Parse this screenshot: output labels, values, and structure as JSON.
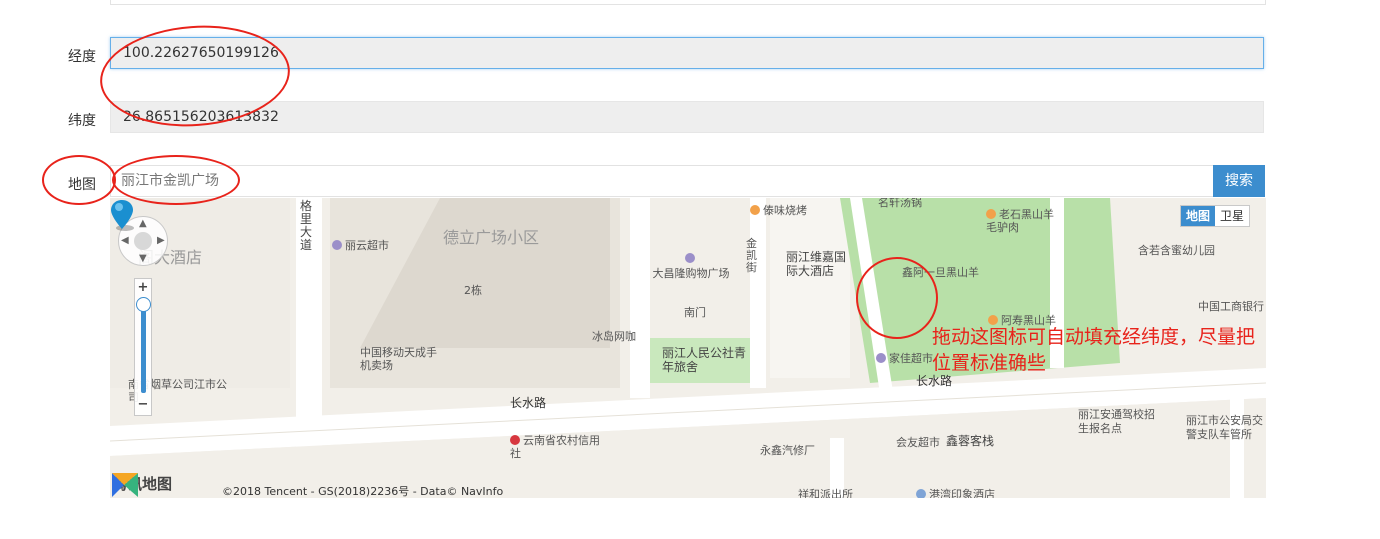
{
  "form": {
    "longitude": {
      "label": "经度",
      "value": "100.22627650199126"
    },
    "latitude": {
      "label": "纬度",
      "value": "26.865156203613832"
    },
    "map": {
      "label": "地图",
      "search_value": "丽江市金凯广场",
      "search_button": "搜索"
    }
  },
  "map": {
    "type_buttons": [
      "地图",
      "卫星"
    ],
    "active_type": "地图",
    "places": {
      "hotel_left": "阁大酒店",
      "road_vertical_1": "格里大道",
      "lijiang_yun": "丽云超市",
      "deli_plaza": "德立广场小区",
      "building_2": "2栋",
      "daichang": "大昌隆购物广场",
      "nanmen": "南门",
      "bingdao": "冰岛网咖",
      "mobile": "中国移动天成手机卖场",
      "yunnan_tobacco": "南省烟草公司江市公司",
      "renmin_hostel": "丽江人民公社青年旅舍",
      "daiwei": "傣味烧烤",
      "jinkai_jie": "金凯街",
      "weijia_hotel": "丽江维嘉国际大酒店",
      "mingxuan": "名轩汤锅",
      "laoshi": "老石黑山羊毛驴肉",
      "xinyang": "鑫阿一旦黑山羊",
      "ashou": "阿寿黑山羊",
      "jiajia": "家佳超市",
      "hanruo": "含若含蜜幼儿园",
      "icbc": "中国工商银行",
      "changshui_1": "长水路",
      "changshui_2": "长水路",
      "rural_credit": "云南省农村信用社",
      "yongxin": "永鑫汽修厂",
      "huiyou": "会友超市",
      "xinrong": "鑫蓉客栈",
      "anton": "丽江安通驾校招生报名点",
      "police_traffic": "丽江市公安局交警支队车管所",
      "xianghe": "祥和派出所",
      "gangwan": "港湾印象酒店"
    },
    "logo_text": "腾讯地图",
    "copyright": "©2018 Tencent - GS(2018)2236号 - Data© NavInfo"
  },
  "annotation": {
    "hint": "拖动这图标可自动填充经纬度，尽量把位置标准确些",
    "ring_color": "#e8231b"
  },
  "colors": {
    "accent": "#3c8dce",
    "annotation": "#e8231b",
    "park": "#b8e0a8"
  }
}
